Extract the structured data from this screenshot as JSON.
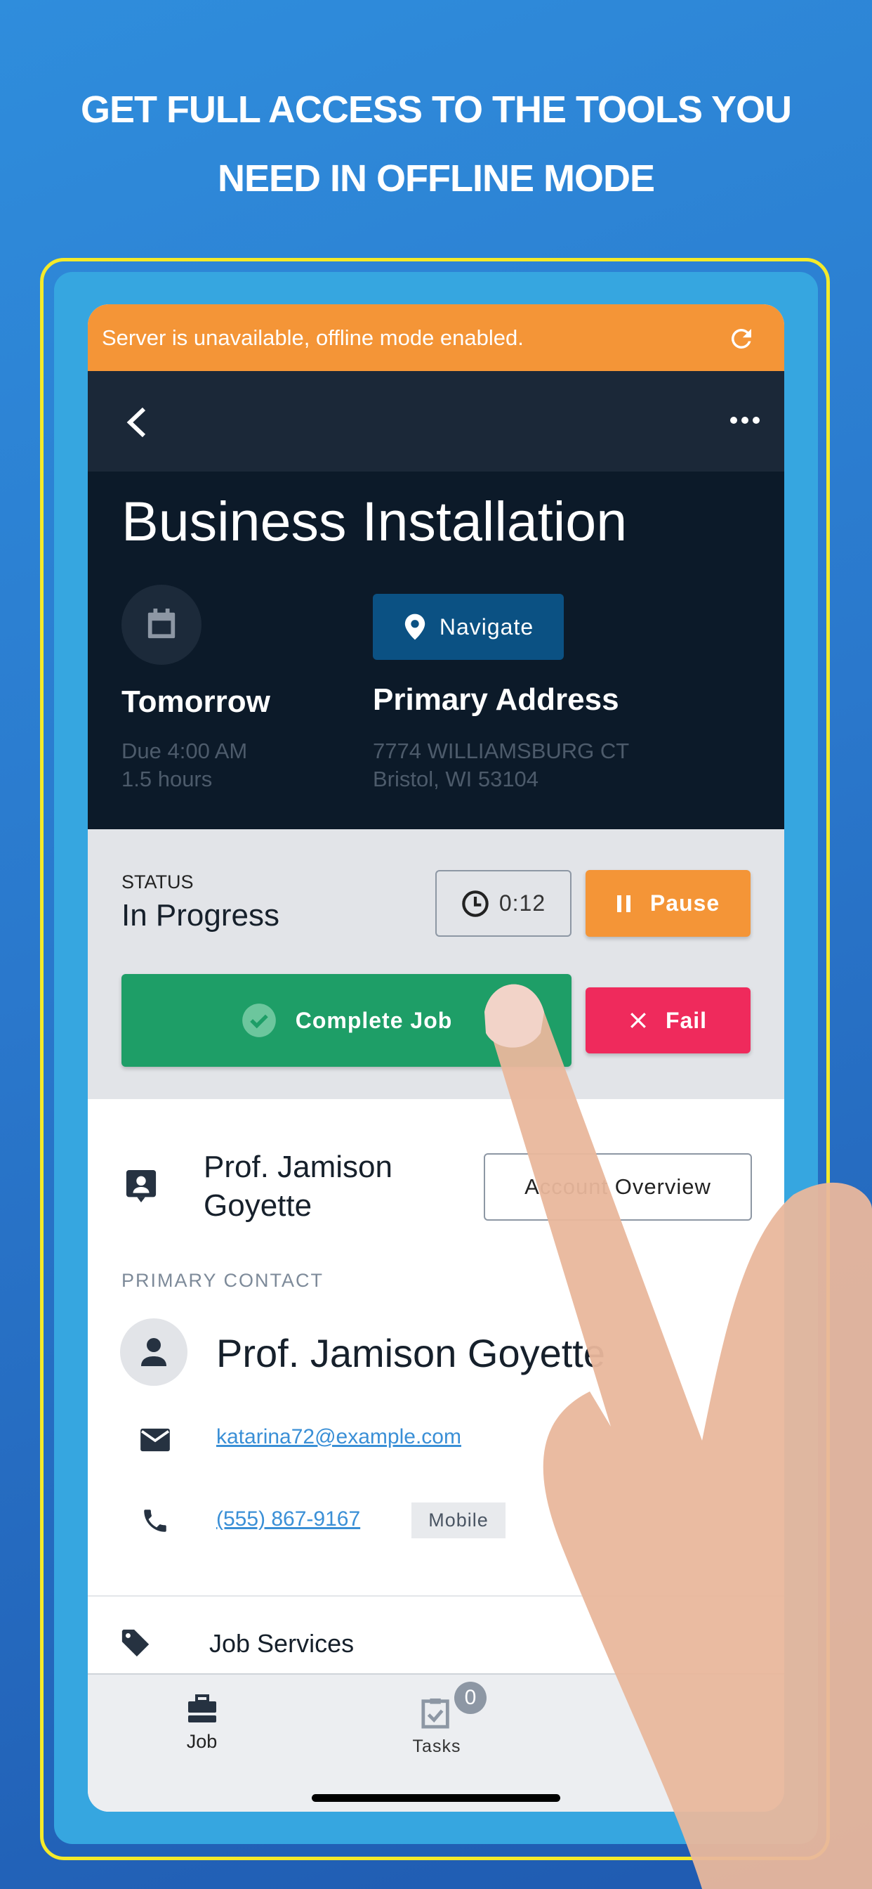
{
  "headline": {
    "line1": "GET FULL ACCESS TO THE TOOLS YOU",
    "line2": "NEED IN OFFLINE MODE"
  },
  "offline_banner": {
    "text": "Server is unavailable, offline mode enabled.",
    "icon": "refresh-icon"
  },
  "nav": {
    "back_icon": "chevron-left-icon",
    "more_icon": "more-horizontal-icon"
  },
  "job": {
    "title": "Business Installation",
    "due": {
      "icon": "calendar-icon",
      "day": "Tomorrow",
      "time": "Due 4:00 AM",
      "duration": "1.5 hours"
    },
    "navigate_label": "Navigate",
    "address": {
      "label": "Primary Address",
      "line1": "7774 WILLIAMSBURG CT",
      "line2": "Bristol, WI 53104"
    }
  },
  "status": {
    "label": "STATUS",
    "value": "In Progress",
    "timer": "0:12",
    "pause_label": "Pause",
    "complete_label": "Complete Job",
    "fail_label": "Fail"
  },
  "account": {
    "name_line1": "Prof. Jamison",
    "name_line2": "Goyette",
    "overview_label": "Account Overview"
  },
  "contact": {
    "section_label": "PRIMARY CONTACT",
    "name": "Prof. Jamison Goyette",
    "email": "katarina72@example.com",
    "phone": "(555) 867-9167",
    "phone_type": "Mobile"
  },
  "services": {
    "label": "Job Services"
  },
  "tabs": [
    {
      "label": "Job",
      "icon": "briefcase-icon"
    },
    {
      "label": "Tasks",
      "icon": "tasks-icon",
      "badge": "0"
    }
  ],
  "colors": {
    "orange": "#f49537",
    "green": "#1e9e67",
    "red": "#ef2a5c",
    "navy": "#0c1a29",
    "navigate": "#0b5183",
    "link": "#3a8fd6",
    "frame_yellow": "#f4ea2a"
  }
}
